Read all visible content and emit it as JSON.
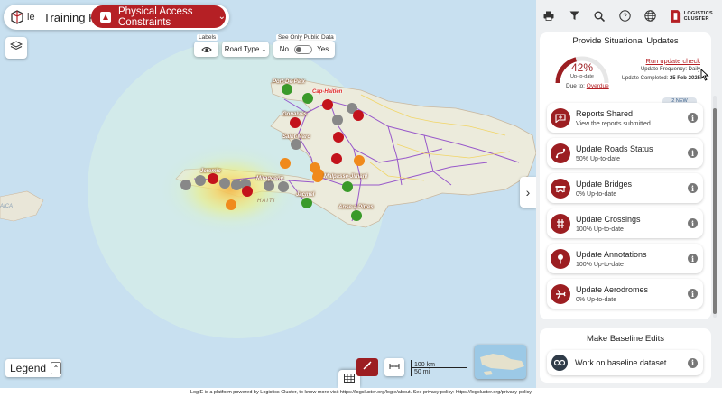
{
  "header": {
    "logo_label": "le",
    "page_title": "Training Page",
    "constraints_button": "Physical Access Constraints"
  },
  "map_controls": {
    "labels_caption": "Labels",
    "road_type": "Road Type",
    "public_caption": "See Only Public Data",
    "toggle_no": "No",
    "toggle_yes": "Yes",
    "legend": "Legend",
    "scale_km": "100 km",
    "scale_mi": "50 mi"
  },
  "places": {
    "port_de_paix": "Port-De-Paix",
    "cap_haitien": "Cap-Haitien",
    "gonaives": "Gonaives",
    "saint_marc": "Saint-Marc",
    "jeremie": "Jeremie",
    "miragoane": "Miragoane",
    "jacmel": "Jacmel",
    "malpasse": "Malpasse-Jimani",
    "anse_a_pitres": "Anse-a-Pitres",
    "haiti": "HAITI",
    "jamaica": "AICA"
  },
  "toolbar_icons": [
    "print-icon",
    "filter-icon",
    "search-icon",
    "help-icon",
    "globe-icon"
  ],
  "brand": {
    "line1": "LOGISTICS",
    "line2": "CLUSTER",
    "color": "#b52025"
  },
  "situational": {
    "title": "Provide Situational Updates",
    "percent": "42%",
    "percent_sub": "Up-to-date",
    "due_label": "Due to:",
    "due_value": "Overdue",
    "run_check": "Run update check",
    "frequency": "Update Frequency: Daily",
    "completed_label": "Update Completed:",
    "completed_value": "25 Feb 2025",
    "new_badge": "2 NEW",
    "gauge_fraction": 0.42,
    "items": [
      {
        "title": "Reports Shared",
        "sub": "View the reports submitted",
        "icon": "report-icon"
      },
      {
        "title": "Update Roads Status",
        "sub": "50% Up-to-date",
        "icon": "road-icon"
      },
      {
        "title": "Update Bridges",
        "sub": "0% Up-to-date",
        "icon": "bridge-icon"
      },
      {
        "title": "Update Crossings",
        "sub": "100% Up-to-date",
        "icon": "crossing-icon"
      },
      {
        "title": "Update Annotations",
        "sub": "100% Up-to-date",
        "icon": "pin-icon"
      },
      {
        "title": "Update Aerodromes",
        "sub": "0% Up-to-date",
        "icon": "plane-icon"
      }
    ]
  },
  "baseline": {
    "title": "Make Baseline Edits",
    "item": "Work on baseline dataset"
  },
  "footer": "LogIE is a platform powered by Logistics Cluster, to know more visit https://logcluster.org/logie/about. See privacy policy: https://logcluster.org/privacy-policy"
}
